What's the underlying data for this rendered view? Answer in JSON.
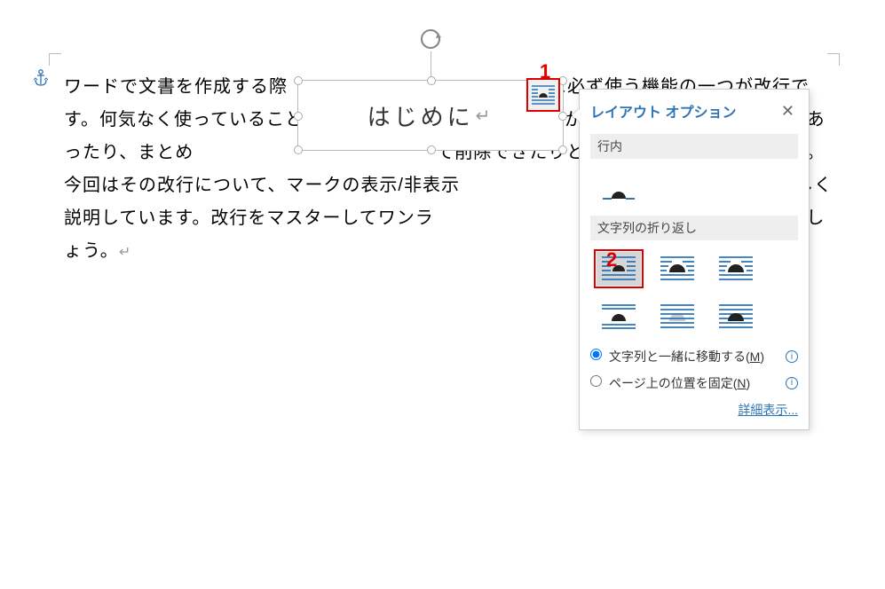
{
  "document": {
    "body_text": "ワードで文書を作成する際　　　　　　　　　　　　　　に必ず使う機能の一つが改行です。何気なく使っていること　　　　　　　　　　　いますが、実は改行は２種類改行があったり、まとめ　　　　　　　　　　　　　て削除できたりと、意外と奥が深い機能です。今回はその改行について、マークの表示/非表示　　　　　　　　　　処法なども交え詳しく説明しています。改行をマスターしてワンラ　　　　　　　　　　成できるようになりましょう。",
    "textbox_text": "はじめに"
  },
  "callouts": {
    "one": "1",
    "two": "2"
  },
  "panel": {
    "title": "レイアウト オプション",
    "section_inline": "行内",
    "section_wrap": "文字列の折り返し",
    "radio_move_with_text": "文字列と一緒に移動する(",
    "radio_move_key": "M",
    "radio_fix_position": "ページ上の位置を固定(",
    "radio_fix_key": "N",
    "close_paren": ")",
    "more": "詳細表示..."
  },
  "icons": {
    "anchor": "anchor",
    "rotate": "rotate"
  }
}
